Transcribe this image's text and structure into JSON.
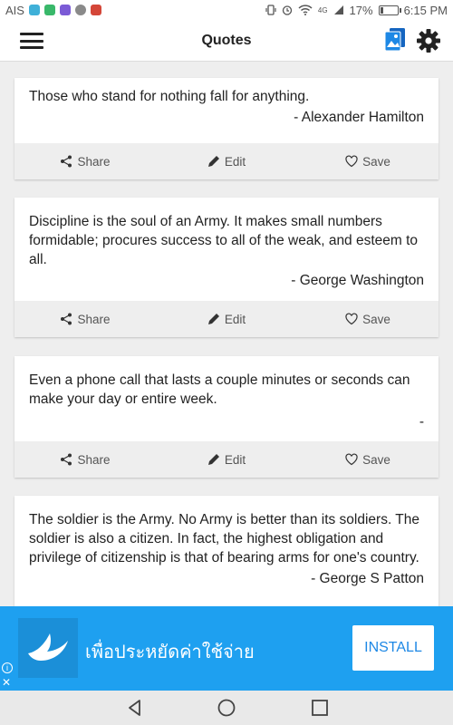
{
  "status_bar": {
    "carrier": "AIS",
    "network": "4G",
    "battery_percent": "17%",
    "battery_level": 0.17,
    "time": "6:15 PM"
  },
  "app_bar": {
    "title": "Quotes",
    "icons": [
      "menu-icon",
      "gallery-icon",
      "gear-icon"
    ]
  },
  "actions": {
    "share": "Share",
    "edit": "Edit",
    "save": "Save"
  },
  "quotes": [
    {
      "text": "Those who stand for nothing fall for anything.",
      "author": "- Alexander Hamilton"
    },
    {
      "text": "Discipline is the soul of an Army. It makes small numbers formidable; procures success to all of the weak, and esteem to all.",
      "author": "- George Washington"
    },
    {
      "text": "Even a phone call that lasts a couple minutes or seconds can make your day or entire week.",
      "author": "-"
    },
    {
      "text": "The soldier is the Army. No Army is better than its soldiers. The soldier is also a citizen. In fact, the highest obligation and privilege of citizenship is that of bearing arms for one's country.",
      "author": "- George S Patton"
    }
  ],
  "ad": {
    "text": "เพื่อประหยัดค่าใช้จ่าย",
    "install": "INSTALL",
    "info": "i",
    "close": "✕",
    "background": "#1ea0f0"
  },
  "colors": {
    "accent": "#1e88e5",
    "card_actions_bg": "#eeeeee"
  }
}
